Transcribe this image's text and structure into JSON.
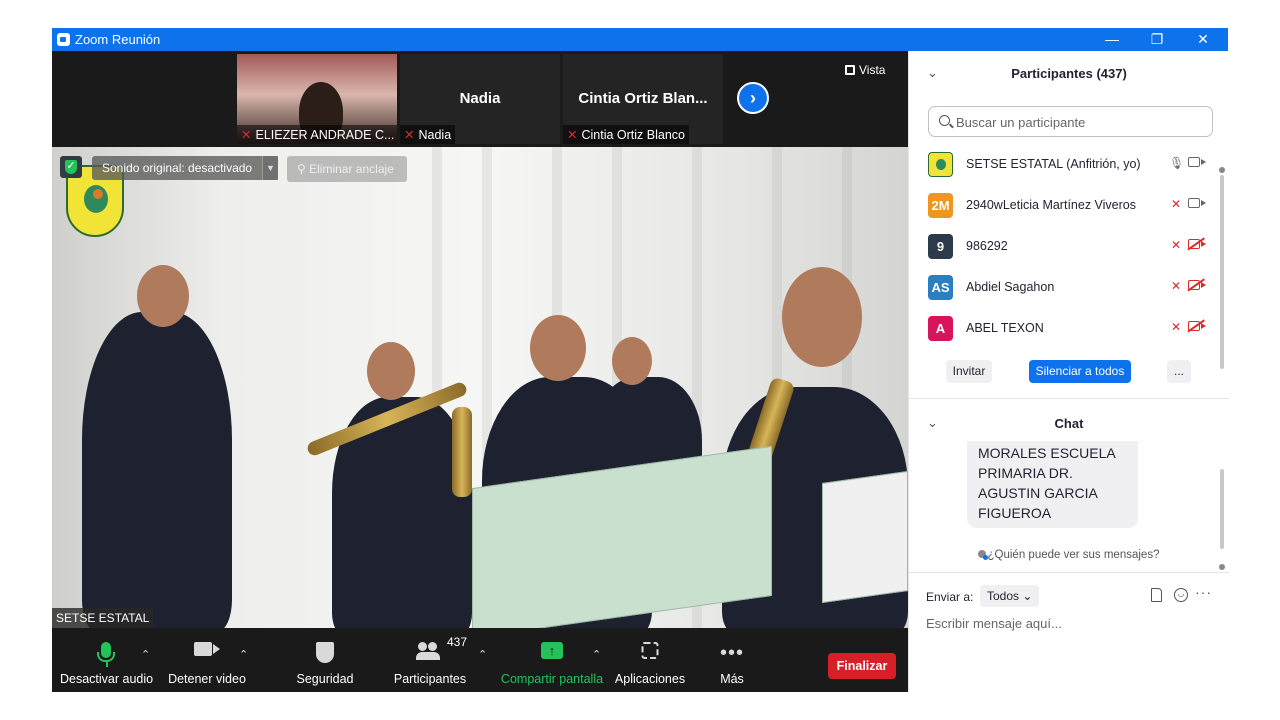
{
  "window": {
    "title": "Zoom Reunión",
    "controls": {
      "minimize": "—",
      "restore": "❐",
      "close": "✕"
    }
  },
  "thumbnails": [
    {
      "name_label": "ELIEZER ANDRADE C...",
      "display_name": "",
      "has_video": true,
      "mic": "muted"
    },
    {
      "name_label": "Nadia",
      "display_name": "Nadia",
      "has_video": false,
      "mic": "muted"
    },
    {
      "name_label": "Cintia Ortiz Blanco",
      "display_name": "Cintia  Ortiz  Blan...",
      "has_video": false,
      "mic": "muted"
    }
  ],
  "thumb_nav_icon": "chevron-right-icon",
  "view_button": {
    "label": "Vista",
    "icon": "grid-icon"
  },
  "main_video": {
    "original_sound_label": "Sonido original: desactivado",
    "unpin_label": "Eliminar anclaje",
    "speaker_name": "SETSE ESTATAL"
  },
  "toolbar": {
    "mute": {
      "label": "Desactivar audio",
      "icon": "microphone-icon"
    },
    "video": {
      "label": "Detener video",
      "icon": "camera-icon"
    },
    "security": {
      "label": "Seguridad",
      "icon": "shield-icon"
    },
    "participants": {
      "label": "Participantes",
      "count": "437",
      "icon": "people-icon"
    },
    "share": {
      "label": "Compartir pantalla",
      "icon": "share-screen-icon",
      "arrow": "↑"
    },
    "apps": {
      "label": "Aplicaciones",
      "icon": "apps-icon"
    },
    "more": {
      "label": "Más",
      "icon": "more-dots-icon",
      "glyph": "•••"
    },
    "end": {
      "label": "Finalizar"
    },
    "caret": "⌃"
  },
  "participants_panel": {
    "title": "Participantes (437)",
    "chevron": "⌄",
    "search_placeholder": "Buscar un participante",
    "list": [
      {
        "avatar_text": "",
        "avatar_color": "#f2e436",
        "avatar_logo": true,
        "name": "SETSE ESTATAL (Anfitrión, yo)",
        "mic": "on",
        "video": "on"
      },
      {
        "avatar_text": "2M",
        "avatar_color": "#f0961e",
        "avatar_logo": false,
        "name": "2940wLeticia Martínez Viveros",
        "mic": "off",
        "video": "on"
      },
      {
        "avatar_text": "9",
        "avatar_color": "#2d3a4a",
        "avatar_logo": false,
        "name": "986292",
        "mic": "off",
        "video": "off"
      },
      {
        "avatar_text": "AS",
        "avatar_color": "#2a7fc1",
        "avatar_logo": false,
        "name": "Abdiel Sagahon",
        "mic": "off",
        "video": "off"
      },
      {
        "avatar_text": "A",
        "avatar_color": "#d8155a",
        "avatar_logo": false,
        "name": "ABEL TEXON",
        "mic": "off",
        "video": "off"
      }
    ],
    "invite_label": "Invitar",
    "mute_all_label": "Silenciar a todos",
    "more_label": "..."
  },
  "chat_panel": {
    "title": "Chat",
    "chevron": "⌄",
    "message_lines": [
      "MORALES  ESCUELA",
      "PRIMARIA DR.",
      "AGUSTIN GARCIA",
      "FIGUEROA"
    ],
    "who_can_see": "¿Quién puede ver sus mensajes?",
    "send_to_label": "Enviar a:",
    "send_to_value": "Todos",
    "send_to_caret": "⌄",
    "input_placeholder": "Escribir mensaje aquí...",
    "more_glyph": "···"
  }
}
